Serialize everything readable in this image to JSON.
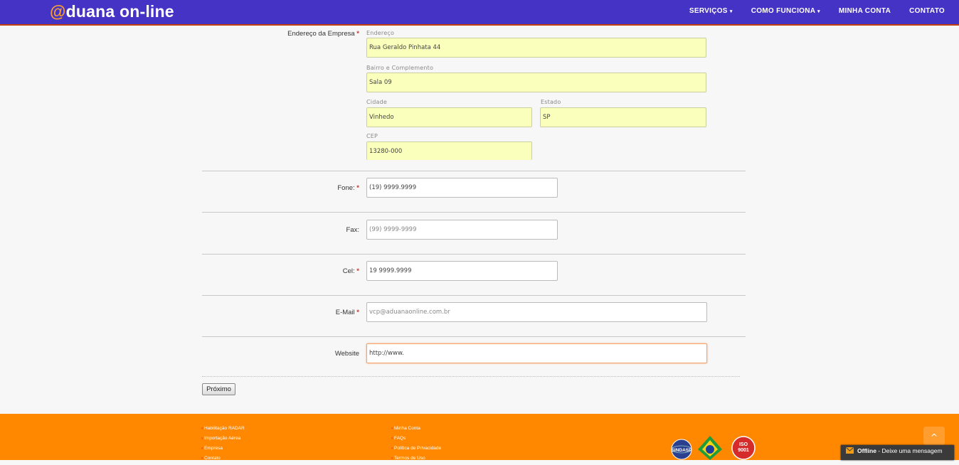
{
  "header": {
    "logo_at": "@",
    "logo_text": "duana on-line",
    "nav": [
      {
        "label": "SERVIÇOS",
        "caret": "▾"
      },
      {
        "label": "COMO FUNCIONA",
        "caret": "▾"
      },
      {
        "label": "MINHA CONTA",
        "caret": ""
      },
      {
        "label": "CONTATO",
        "caret": ""
      }
    ]
  },
  "form": {
    "address": {
      "label": "Endereço da Empresa",
      "required_mark": "*",
      "endereco": {
        "label": "Endereço",
        "value": "Rua Geraldo Pinhata 44"
      },
      "bairro": {
        "label": "Bairro e Complemento",
        "value": "Sala 09"
      },
      "cidade": {
        "label": "Cidade",
        "value": "Vinhedo"
      },
      "estado": {
        "label": "Estado",
        "value": "SP"
      },
      "cep": {
        "label": "CEP",
        "value": "13280-000"
      }
    },
    "fone": {
      "label": "Fone:",
      "required_mark": "*",
      "value": "(19) 9999.9999"
    },
    "fax": {
      "label": "Fax:",
      "placeholder": "(99) 9999-9999"
    },
    "cel": {
      "label": "Cel:",
      "required_mark": "*",
      "value": "19 9999.9999"
    },
    "email": {
      "label": "E-Mail",
      "required_mark": "*",
      "placeholder": "vcp@aduanaonline.com.br"
    },
    "website": {
      "label": "Website",
      "value": "http://www."
    },
    "next_button": "Próximo"
  },
  "footer": {
    "col1": [
      "Habilitação RADAR",
      "Importação Aérea",
      "Empresa",
      "Contato"
    ],
    "col2": [
      "Minha Conta",
      "FAQs",
      "Política de Privacidade",
      "Termos de Uso"
    ],
    "badges": [
      "SINDASP",
      "ISO 9001"
    ],
    "back_to_top": "^"
  },
  "chat": {
    "status": "Offline",
    "separator": " - ",
    "message": "Deixe uma mensagem"
  },
  "colors": {
    "header_bg": "#4533c6",
    "logo_accent": "#f59c33",
    "footer_bg": "#ff8800",
    "filled_field_bg": "#fbffbc"
  }
}
